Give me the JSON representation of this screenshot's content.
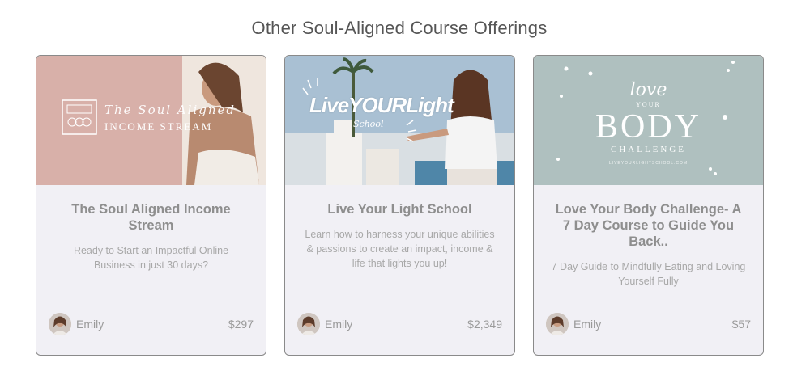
{
  "section": {
    "title": "Other Soul-Aligned Course Offerings"
  },
  "courses": [
    {
      "title": "The Soul Aligned Income Stream",
      "description": "Ready to Start an Impactful Online Business in just 30 days?",
      "author": "Emily",
      "price": "$297",
      "thumbnail": {
        "line1": "The Soul Aligned",
        "line2": "INCOME STREAM",
        "background": "#dcb3ac"
      }
    },
    {
      "title": "Live Your Light School",
      "description": "Learn how to harness your unique abilities & passions to create an impact, income & life that lights you up!",
      "author": "Emily",
      "price": "$2,349",
      "thumbnail": {
        "line1": "LiveYOURLight",
        "line2": "School",
        "background": "#9fb6c9"
      }
    },
    {
      "title": "Love Your Body Challenge- A 7 Day Course to Guide You Back..",
      "description": "7 Day Guide to Mindfully Eating and Loving Yourself Fully",
      "author": "Emily",
      "price": "$57",
      "thumbnail": {
        "love": "love",
        "your": "YOUR",
        "body": "BODY",
        "challenge": "CHALLENGE",
        "small": "LIVEYOURLIGHTSCHOOL.COM",
        "background": "#aebfbf"
      }
    }
  ]
}
